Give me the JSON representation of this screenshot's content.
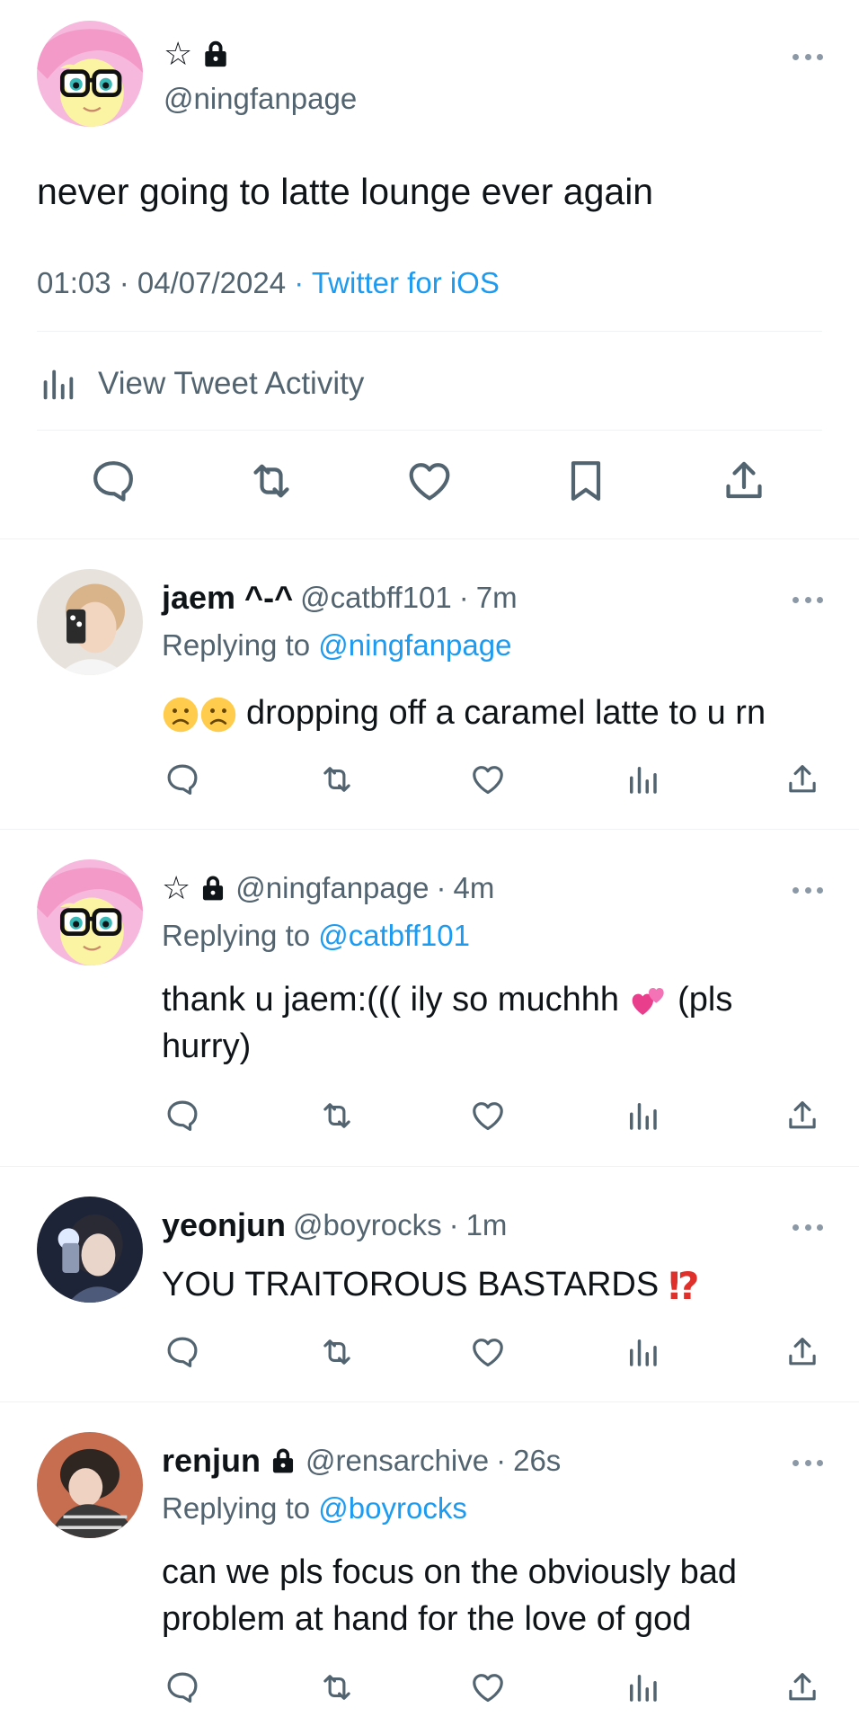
{
  "main_tweet": {
    "name": "☆",
    "handle": "@ningfanpage",
    "text": "never going to latte lounge ever again",
    "time": "01:03",
    "sep1": " · ",
    "date": "04/07/2024",
    "sep2": " · ",
    "source": "Twitter for iOS",
    "activity_label": "View Tweet Activity",
    "actions": [
      "reply-icon",
      "retweet-icon",
      "like-icon",
      "bookmark-icon",
      "share-icon"
    ]
  },
  "replies": [
    {
      "name": "jaem ^-^",
      "handle": "@catbff101",
      "sep": "·",
      "time": "7m",
      "replying_prefix": "Replying to ",
      "replying_to": "@ningfanpage",
      "text": "dropping off a caramel latte to u rn",
      "emoji_prefix": "frowning-face x2"
    },
    {
      "name": "☆",
      "handle": "@ningfanpage",
      "sep": "·",
      "time": "4m",
      "replying_prefix": "Replying to ",
      "replying_to": "@catbff101",
      "text_a": "thank u jaem:((( ily so muchhh ",
      "text_b": " (pls hurry)",
      "emoji_inline": "two-hearts"
    },
    {
      "name": "yeonjun",
      "handle": "@boyrocks",
      "sep": "·",
      "time": "1m",
      "text": "YOU TRAITOROUS BASTARDS ",
      "emoji_suffix": "interrobang"
    },
    {
      "name": "renjun",
      "handle": "@rensarchive",
      "sep": "·",
      "time": "26s",
      "replying_prefix": "Replying to ",
      "replying_to": "@boyrocks",
      "text": "can we pls focus on the obviously bad problem at hand for the love of god"
    }
  ],
  "reply_actions": [
    "reply-icon",
    "retweet-icon",
    "like-icon",
    "views-icon",
    "share-icon"
  ],
  "colors": {
    "link": "#1d9bf0",
    "secondary_text": "#536471",
    "primary_text": "#0f1419",
    "icon": "#536471",
    "divider": "#eff3f4"
  }
}
